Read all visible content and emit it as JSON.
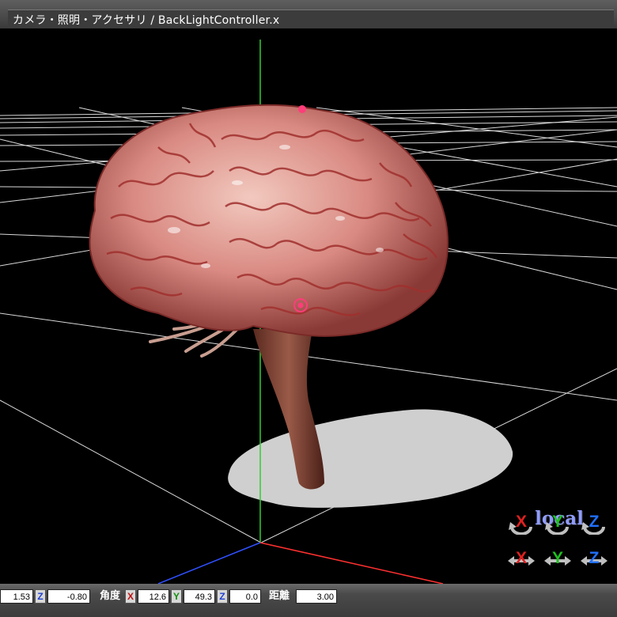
{
  "window": {
    "title": "カメラ・照明・アクセサリ / BackLightController.x"
  },
  "viewport": {
    "model_description": "brain",
    "local_mode_label": "local",
    "rotate_gizmos": [
      {
        "axis": "X",
        "color": "#e02020"
      },
      {
        "axis": "Y",
        "color": "#20c020"
      },
      {
        "axis": "Z",
        "color": "#2070ff"
      }
    ],
    "move_gizmos": [
      {
        "axis": "X",
        "color": "#e02020"
      },
      {
        "axis": "Y",
        "color": "#20c020"
      },
      {
        "axis": "Z",
        "color": "#2070ff"
      }
    ]
  },
  "bottom_bar": {
    "position_y_value": "1.53",
    "position_z_label": "Z",
    "position_z_value": "-0.80",
    "angle_label": "角度",
    "angle_x_label": "X",
    "angle_x_value": "12.6",
    "angle_y_label": "Y",
    "angle_y_value": "49.3",
    "angle_z_label": "Z",
    "angle_z_value": "0.0",
    "distance_label": "距離",
    "distance_value": "3.00"
  },
  "colors": {
    "x_axis": "#ff3030",
    "y_axis": "#30d030",
    "z_axis": "#3050ff",
    "grid": "#ffffff",
    "shadow": "#cfcfcf"
  }
}
